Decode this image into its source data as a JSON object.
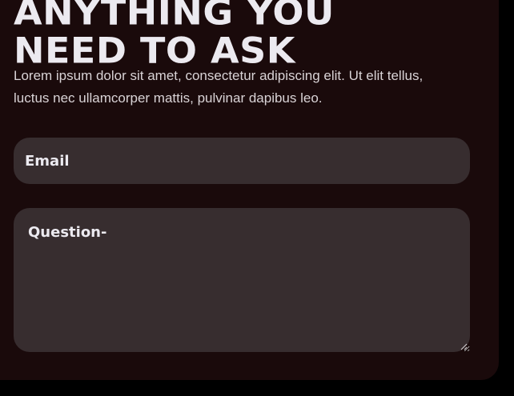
{
  "heading": {
    "line1": "ANYTHING YOU",
    "line2": "NEED TO ASK"
  },
  "intro": "Lorem ipsum dolor sit amet, consectetur adipiscing elit. Ut elit tellus, luctus nec ullamcorper mattis, pulvinar dapibus leo.",
  "form": {
    "email": {
      "placeholder": "Email",
      "value": ""
    },
    "question": {
      "placeholder": "Question-",
      "value": ""
    }
  },
  "colors": {
    "page_background": "#000000",
    "panel_background": "#1a0a0b",
    "field_background": "#372d2f",
    "heading_text": "#eceaf0",
    "body_text": "#d9d3d6"
  },
  "icons": {
    "textarea_resize": "resize-grip-icon"
  }
}
